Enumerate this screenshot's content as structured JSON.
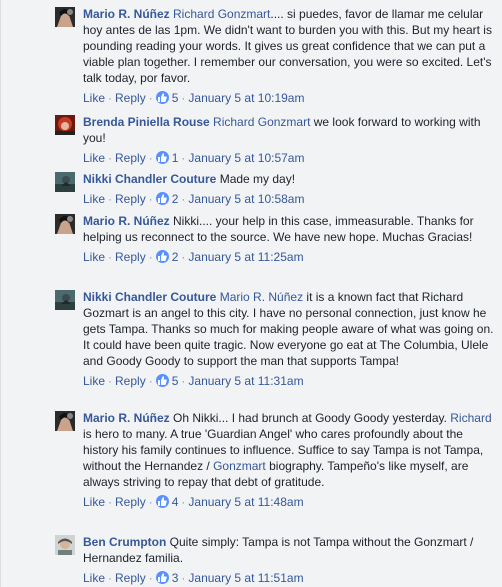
{
  "comments": [
    {
      "author": "Mario R. Núñez",
      "parts": [
        {
          "t": "tag",
          "v": "Richard Gonzmart"
        },
        {
          "t": "text",
          "v": ".... si puedes, favor de llamar me celular hoy antes de las 1pm. We didn't want to burden you with this. But my heart is pounding reading your words. It gives us great confidence that we can put a viable plan together. I remember our conversation, you were so excited. Let's talk today, por favor."
        }
      ],
      "like_label": "Like",
      "reply_label": "Reply",
      "likes": "5",
      "time": "January 5 at 10:19am",
      "avatar": "mario-avatar"
    },
    {
      "author": "Brenda Piniella Rouse",
      "parts": [
        {
          "t": "tag",
          "v": "Richard Gonzmart"
        },
        {
          "t": "text",
          "v": " we look forward to working with you!"
        }
      ],
      "like_label": "Like",
      "reply_label": "Reply",
      "likes": "1",
      "time": "January 5 at 10:57am",
      "avatar": "brenda-avatar"
    },
    {
      "author": "Nikki Chandler Couture",
      "parts": [
        {
          "t": "text",
          "v": "Made my day!"
        }
      ],
      "like_label": "Like",
      "reply_label": "Reply",
      "likes": "2",
      "time": "January 5 at 10:58am",
      "avatar": "nikki-avatar"
    },
    {
      "author": "Mario R. Núñez",
      "parts": [
        {
          "t": "text",
          "v": "Nikki.... your help in this case, immeasurable. Thanks for helping us reconnect to the source. We have new hope. Muchas Gracias!"
        }
      ],
      "like_label": "Like",
      "reply_label": "Reply",
      "likes": "2",
      "time": "January 5 at 11:25am",
      "avatar": "mario-avatar"
    },
    {
      "author": "Nikki Chandler Couture",
      "parts": [
        {
          "t": "tag",
          "v": "Mario R. Núñez"
        },
        {
          "t": "text",
          "v": " it is a known fact that Richard Gozmart is an angel to this city. I have no personal connection, just know he gets Tampa. Thanks so much for making people aware of what was going on. It could have been quite tragic. Now everyone go eat at The Columbia, Ulele and Goody Goody to support the man that supports Tampa!"
        }
      ],
      "like_label": "Like",
      "reply_label": "Reply",
      "likes": "5",
      "time": "January 5 at 11:31am",
      "avatar": "nikki-avatar"
    },
    {
      "author": "Mario R. Núñez",
      "parts": [
        {
          "t": "text",
          "v": "Oh Nikki... I had brunch at Goody Goody yesterday. "
        },
        {
          "t": "tag",
          "v": "Richard"
        },
        {
          "t": "text",
          "v": " is hero to many. A true 'Guardian Angel' who cares profoundly about the history his family continues to influence. Suffice to say Tampa is not Tampa, without the Hernandez / "
        },
        {
          "t": "tag",
          "v": "Gonzmart"
        },
        {
          "t": "text",
          "v": " biography. Tampeño's like myself, are always striving to repay that debt of gratitude."
        }
      ],
      "like_label": "Like",
      "reply_label": "Reply",
      "likes": "4",
      "time": "January 5 at 11:48am",
      "avatar": "mario-avatar"
    },
    {
      "author": "Ben Crumpton",
      "parts": [
        {
          "t": "text",
          "v": "Quite simply: Tampa is not Tampa without the Gonzmart / Hernandez familia."
        }
      ],
      "like_label": "Like",
      "reply_label": "Reply",
      "likes": "3",
      "time": "January 5 at 11:51am",
      "avatar": "ben-avatar"
    }
  ],
  "colors": {
    "link": "#365899",
    "like_badge": "#5890ff",
    "meta": "#4b4f56"
  }
}
